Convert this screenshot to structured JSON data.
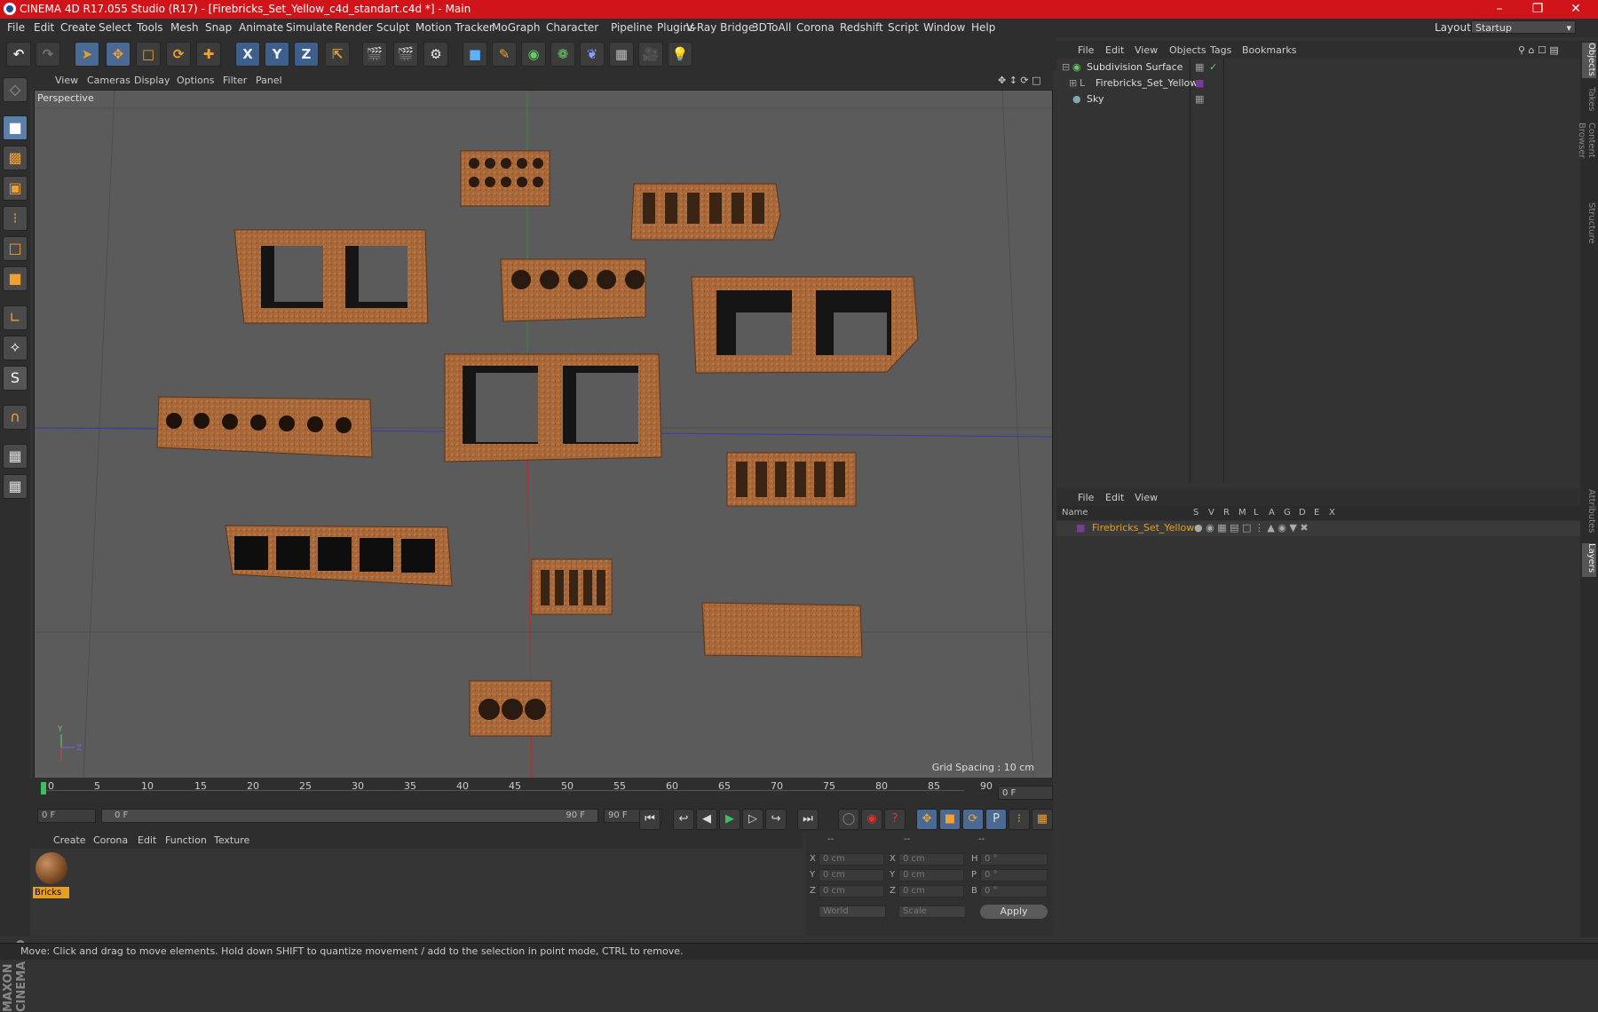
{
  "title": "CINEMA 4D R17.055 Studio (R17) - [Firebricks_Set_Yellow_c4d_standart.c4d *] - Main",
  "menubar": [
    "File",
    "Edit",
    "Create",
    "Select",
    "Tools",
    "Mesh",
    "Snap",
    "Animate",
    "Simulate",
    "Render",
    "Sculpt",
    "Motion Tracker",
    "MoGraph",
    "Character",
    "Pipeline",
    "Plugins",
    "V-Ray Bridge",
    "3DToAll",
    "Corona",
    "Redshift",
    "Script",
    "Window",
    "Help"
  ],
  "layout": {
    "label": "Layout:",
    "value": "Startup"
  },
  "viewport": {
    "menu": [
      "View",
      "Cameras",
      "Display",
      "Options",
      "Filter",
      "Panel"
    ],
    "label": "Perspective",
    "grid_spacing": "Grid Spacing : 10 cm"
  },
  "timeline": {
    "ticks": [
      "0",
      "5",
      "10",
      "15",
      "20",
      "25",
      "30",
      "35",
      "40",
      "45",
      "50",
      "55",
      "60",
      "65",
      "70",
      "75",
      "80",
      "85",
      "90"
    ],
    "frame_right": "0 F",
    "start": "0 F",
    "slider_left": "0 F",
    "slider_right": "90 F",
    "end": "90 F"
  },
  "material_manager": {
    "menu": [
      "Create",
      "Corona",
      "Edit",
      "Function",
      "Texture"
    ],
    "material": "Bricks"
  },
  "coords": {
    "headers": [
      "--",
      "--",
      "--"
    ],
    "rows": [
      {
        "a": "X",
        "av": "0 cm",
        "b": "X",
        "bv": "0 cm",
        "c": "H",
        "cv": "0 °"
      },
      {
        "a": "Y",
        "av": "0 cm",
        "b": "Y",
        "bv": "0 cm",
        "c": "P",
        "cv": "0 °"
      },
      {
        "a": "Z",
        "av": "0 cm",
        "b": "Z",
        "bv": "0 cm",
        "c": "B",
        "cv": "0 °"
      }
    ],
    "world": "World",
    "scale": "Scale",
    "apply": "Apply"
  },
  "object_manager": {
    "menu": [
      "File",
      "Edit",
      "View",
      "Objects",
      "Tags",
      "Bookmarks"
    ],
    "objects": [
      "Subdivision Surface",
      "Firebricks_Set_Yellow",
      "Sky"
    ]
  },
  "layer_manager": {
    "menu": [
      "File",
      "Edit",
      "View"
    ],
    "columns": [
      "Name",
      "S",
      "V",
      "R",
      "M",
      "L",
      "A",
      "G",
      "D",
      "E",
      "X"
    ],
    "layer": "Firebricks_Set_Yellow"
  },
  "side_tabs": [
    "Objects",
    "Takes",
    "Content Browser",
    "Structure",
    "Attributes",
    "Layers"
  ],
  "brand": "MAXON CINEMA 4D",
  "status": "Move: Click and drag to move elements. Hold down SHIFT to quantize movement / add to the selection in point mode, CTRL to remove.",
  "colors": {
    "titlebar": "#d0141a",
    "brick": "#a8683a",
    "material_tag": "#e6a020",
    "layer_name": "#e6a020"
  }
}
